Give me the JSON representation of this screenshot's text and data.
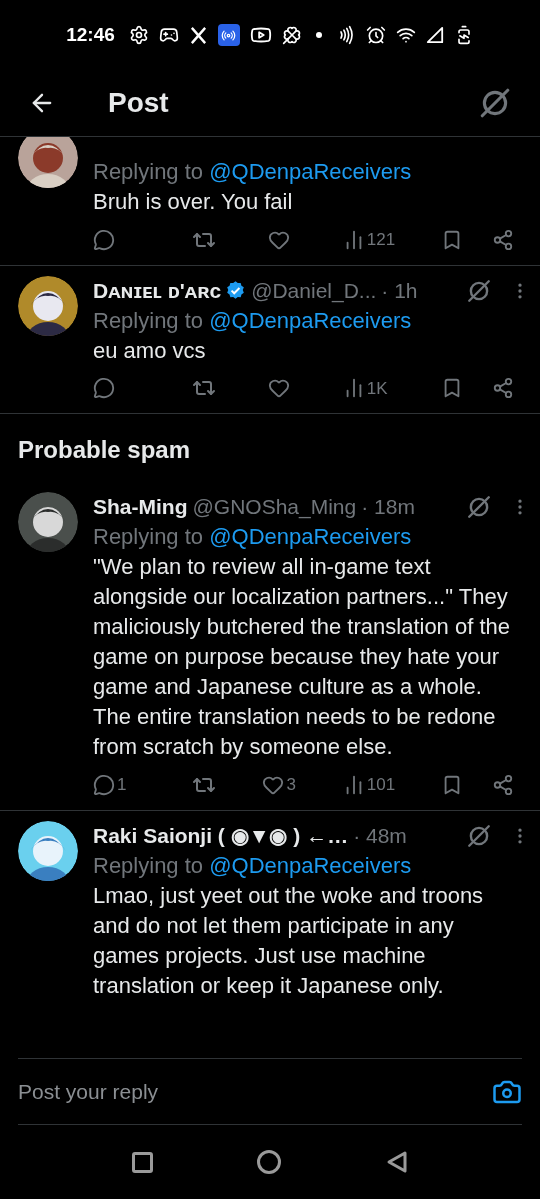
{
  "status_bar": {
    "time": "12:46"
  },
  "header": {
    "title": "Post"
  },
  "feed": [
    {
      "kind": "post",
      "replying_label": "Replying to",
      "reply_to": "@QDenpaReceivers",
      "text": "Bruh is over. You fail",
      "views": "121"
    },
    {
      "kind": "post",
      "name": "Dᴀɴɪᴇʟ ᴅ'ᴀʀᴄ",
      "verified": true,
      "handle": "@Daniel_D...",
      "time": "· 1h",
      "replying_label": "Replying to",
      "reply_to": "@QDenpaReceivers",
      "text": "eu amo vcs",
      "views": "1K"
    },
    {
      "kind": "heading",
      "text": "Probable spam"
    },
    {
      "kind": "post",
      "name": "Sha-Ming",
      "verified": false,
      "handle": "@GNOSha_Ming",
      "time": "· 18m",
      "replying_label": "Replying to",
      "reply_to": "@QDenpaReceivers",
      "text": "\"We plan to review all in-game text alongside our localization partners...\" They maliciously butchered the translation of the game on purpose because they hate your game and Japanese culture as a whole. The entire translation needs to be redone from scratch by someone else.",
      "replies": "1",
      "likes": "3",
      "views": "101"
    },
    {
      "kind": "post",
      "name": "Raki Saionji ( ◉▼◉ ) ←…",
      "verified": false,
      "time": "· 48m",
      "replying_label": "Replying to",
      "reply_to": "@QDenpaReceivers",
      "text": "Lmao, just yeet out the woke and troons and do not let them participate in any games projects. Just use machine translation or keep it Japanese only."
    }
  ],
  "reply_bar": {
    "placeholder": "Post your reply"
  }
}
